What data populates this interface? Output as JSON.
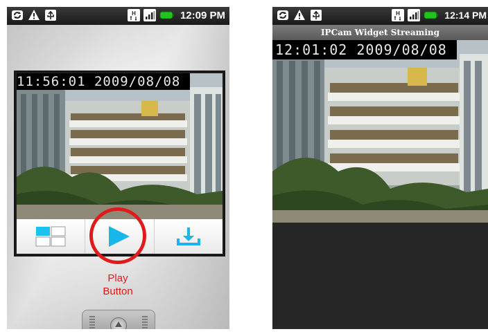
{
  "left_phone": {
    "status_bar": {
      "time": "12:09 PM",
      "icons_left": [
        "sync-icon",
        "warning-icon",
        "usb-icon"
      ],
      "icons_right": [
        "data-icon",
        "signal-icon",
        "battery-icon"
      ]
    },
    "widget": {
      "timestamp": "11:56:01 2009/08/08",
      "controls": [
        "layout-grid-icon",
        "play-icon",
        "download-icon"
      ]
    },
    "annotation": {
      "line1": "Play",
      "line2": "Button",
      "color": "#e01a1a"
    }
  },
  "right_phone": {
    "status_bar": {
      "time": "12:14 PM",
      "icons_left": [
        "sync-icon",
        "warning-icon",
        "usb-icon"
      ],
      "icons_right": [
        "data-icon",
        "signal-icon",
        "battery-icon"
      ]
    },
    "title": "IPCam Widget Streaming",
    "timestamp": "12:01:02 2009/08/08"
  },
  "colors": {
    "accent": "#19b6ea",
    "annotation": "#e01a1a"
  }
}
